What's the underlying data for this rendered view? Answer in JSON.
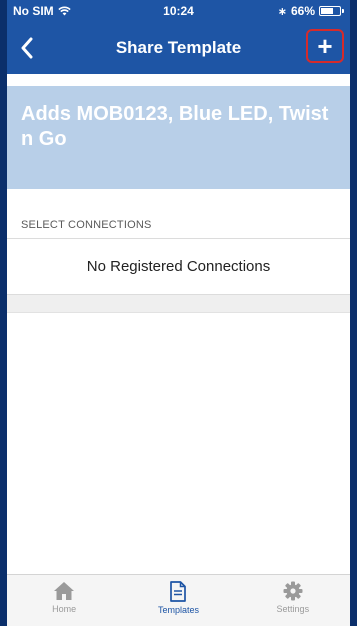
{
  "status_bar": {
    "carrier": "No SIM",
    "time": "10:24",
    "battery_text": "66%",
    "battery_level": 0.66
  },
  "nav": {
    "back_icon": "chevron-left-icon",
    "title": "Share Template",
    "add_label": "+"
  },
  "template": {
    "title": "Adds MOB0123, Blue LED, Twist n Go"
  },
  "connections": {
    "section_label": "SELECT CONNECTIONS",
    "empty_text": "No Registered Connections"
  },
  "tabs": [
    {
      "label": "Home",
      "icon": "home-icon",
      "active": false
    },
    {
      "label": "Templates",
      "icon": "document-icon",
      "active": true
    },
    {
      "label": "Settings",
      "icon": "gear-icon",
      "active": false
    }
  ],
  "colors": {
    "primary": "#1e55a5",
    "header_band": "#b8cfe8",
    "highlight": "#d62b2b",
    "tab_inactive": "#9a9a9a"
  }
}
